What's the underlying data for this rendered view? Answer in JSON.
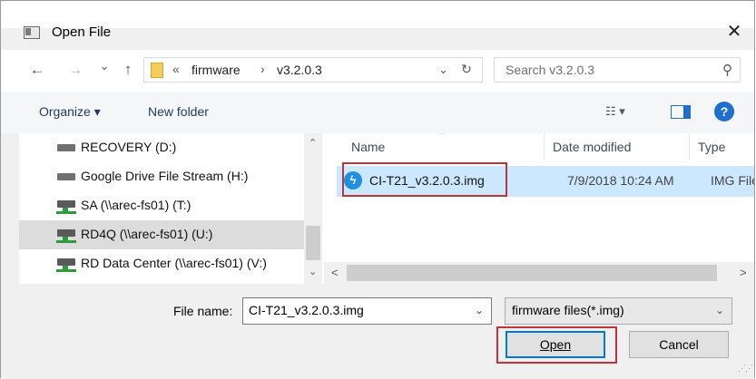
{
  "window": {
    "title": "Open File",
    "close_glyph": "✕"
  },
  "address_bar": {
    "prefix": "«",
    "crumbs": [
      "firmware",
      "v3.2.0.3"
    ],
    "separator": "›",
    "back_glyph": "←",
    "forward_glyph": "→",
    "recent_glyph": "⌄",
    "up_glyph": "↑",
    "dropdown_glyph": "⌄",
    "refresh_glyph": "↻"
  },
  "search": {
    "placeholder": "Search v3.2.0.3",
    "icon_glyph": "⚲"
  },
  "toolbar": {
    "organize_label": "Organize ▾",
    "new_folder_label": "New folder",
    "view_glyph": "☷ ▾",
    "help_glyph": "?"
  },
  "nav_pane": {
    "items": [
      {
        "label": "RECOVERY (D:)",
        "icon": "drive-icon"
      },
      {
        "label": "Google Drive File Stream (H:)",
        "icon": "drive-icon"
      },
      {
        "label": "SA (\\\\arec-fs01) (T:)",
        "icon": "network-drive-icon"
      },
      {
        "label": "RD4Q (\\\\arec-fs01) (U:)",
        "icon": "network-drive-icon",
        "selected": true
      },
      {
        "label": "RD Data Center (\\\\arec-fs01) (V:)",
        "icon": "network-drive-icon"
      }
    ],
    "scroll_up": "⌃",
    "scroll_down": "⌄"
  },
  "file_list": {
    "columns": [
      "Name",
      "Date modified",
      "Type"
    ],
    "sort_indicator": "⌃",
    "rows": [
      {
        "name": "CI-T21_v3.2.0.3.img",
        "date": "7/9/2018 10:24 AM",
        "type": "IMG File",
        "icon_glyph": "ϟ",
        "selected": true
      }
    ],
    "scroll_left": "<",
    "scroll_right": ">"
  },
  "bottom": {
    "file_name_label": "File name:",
    "file_name_value": "CI-T21_v3.2.0.3.img",
    "filter_value": "firmware files(*.img)",
    "dropdown_glyph": "⌄",
    "open_label": "Open",
    "cancel_label": "Cancel",
    "grip_glyph": "⋰⋰"
  },
  "colors": {
    "selection": "#cce8ff",
    "highlight_border": "#c0333b",
    "accent": "#0078d7"
  }
}
